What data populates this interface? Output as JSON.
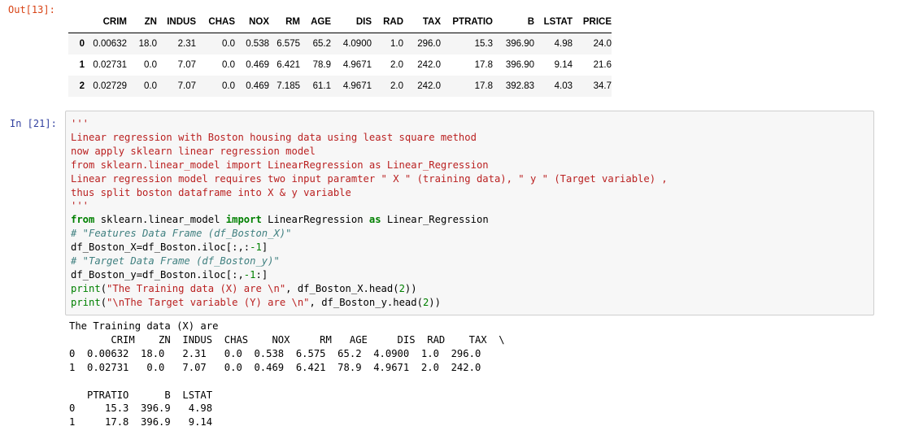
{
  "out_prompt": "Out[13]:",
  "in_prompt": "In [21]:",
  "table": {
    "columns": [
      "CRIM",
      "ZN",
      "INDUS",
      "CHAS",
      "NOX",
      "RM",
      "AGE",
      "DIS",
      "RAD",
      "TAX",
      "PTRATIO",
      "B",
      "LSTAT",
      "PRICE"
    ],
    "rows": [
      {
        "index": "0",
        "cells": [
          "0.00632",
          "18.0",
          "2.31",
          "0.0",
          "0.538",
          "6.575",
          "65.2",
          "4.0900",
          "1.0",
          "296.0",
          "15.3",
          "396.90",
          "4.98",
          "24.0"
        ]
      },
      {
        "index": "1",
        "cells": [
          "0.02731",
          "0.0",
          "7.07",
          "0.0",
          "0.469",
          "6.421",
          "78.9",
          "4.9671",
          "2.0",
          "242.0",
          "17.8",
          "396.90",
          "9.14",
          "21.6"
        ]
      },
      {
        "index": "2",
        "cells": [
          "0.02729",
          "0.0",
          "7.07",
          "0.0",
          "0.469",
          "7.185",
          "61.1",
          "4.9671",
          "2.0",
          "242.0",
          "17.8",
          "392.83",
          "4.03",
          "34.7"
        ]
      }
    ]
  },
  "code": {
    "doc_open": "'''",
    "doc_lines": [
      "Linear regression with Boston housing data using least square method",
      "now apply sklearn linear regression model",
      "from sklearn.linear_model import LinearRegression as Linear_Regression",
      "Linear regression model requires two input paramter \" X \" (training data), \" y \" (Target variable) ,",
      "thus split boston dataframe into X & y variable"
    ],
    "doc_close": "'''",
    "import_line": {
      "kw_from": "from",
      "module": " sklearn.linear_model ",
      "kw_import": "import",
      "name": " LinearRegression ",
      "kw_as": "as",
      "alias": " Linear_Regression"
    },
    "comment1": "# \"Features Data Frame (df_Boston_X)\"",
    "line_x": {
      "pre": "df_Boston_X=df_Boston.iloc[:,:",
      "num": "-1",
      "post": "]"
    },
    "comment2": "# \"Target Data Frame (df_Boston_y)\"",
    "line_y": {
      "pre": "df_Boston_y=df_Boston.iloc[:,",
      "num": "-1",
      "post": ":]"
    },
    "print1": {
      "fn": "print",
      "open": "(",
      "str": "\"The Training data (X) are \\n\"",
      "rest": ", df_Boston_X.head(",
      "num": "2",
      "close": "))"
    },
    "print2": {
      "fn": "print",
      "open": "(",
      "str": "\"\\nThe Target variable (Y) are \\n\"",
      "rest": ", df_Boston_y.head(",
      "num": "2",
      "close": "))"
    }
  },
  "output_lines": [
    "The Training data (X) are",
    "       CRIM    ZN  INDUS  CHAS    NOX     RM   AGE     DIS  RAD    TAX  \\",
    "0  0.00632  18.0   2.31   0.0  0.538  6.575  65.2  4.0900  1.0  296.0",
    "1  0.02731   0.0   7.07   0.0  0.469  6.421  78.9  4.9671  2.0  242.0",
    "",
    "   PTRATIO      B  LSTAT",
    "0     15.3  396.9   4.98",
    "1     17.8  396.9   9.14"
  ]
}
